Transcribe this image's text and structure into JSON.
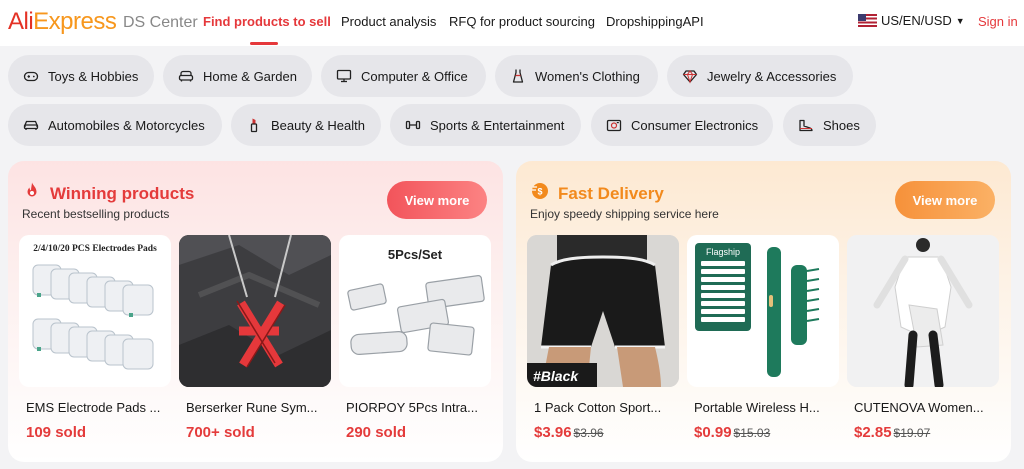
{
  "header": {
    "logo": {
      "ali": "Ali",
      "express": "Express"
    },
    "ds_center": "DS Center",
    "nav": [
      {
        "label": "Find products to sell",
        "active": true
      },
      {
        "label": "Product analysis"
      },
      {
        "label": "RFQ for product sourcing"
      },
      {
        "label": "DropshippingAPI"
      }
    ],
    "region": "US/EN/USD",
    "region_icon": "us-flag-icon",
    "sign_in": "Sign in"
  },
  "categories": [
    {
      "label": "Toys & Hobbies",
      "icon": "gamepad-icon"
    },
    {
      "label": "Home & Garden",
      "icon": "sofa-icon"
    },
    {
      "label": "Computer & Office",
      "icon": "monitor-icon"
    },
    {
      "label": "Women's Clothing",
      "icon": "dress-icon"
    },
    {
      "label": "Jewelry & Accessories",
      "icon": "diamond-icon"
    },
    {
      "label": "Automobiles & Motorcycles",
      "icon": "car-icon"
    },
    {
      "label": "Beauty & Health",
      "icon": "lipstick-icon"
    },
    {
      "label": "Sports & Entertainment",
      "icon": "dumbbell-icon"
    },
    {
      "label": "Consumer Electronics",
      "icon": "camera-icon"
    },
    {
      "label": "Shoes",
      "icon": "shoe-icon"
    }
  ],
  "winning": {
    "title": "Winning products",
    "subtitle": "Recent bestselling products",
    "view_more": "View more",
    "icon": "flame-icon",
    "accent": "#e43b3b",
    "products": [
      {
        "title": "EMS Electrode Pads ...",
        "sold": "109 sold",
        "image_text": "2/4/10/20 PCS Electrodes Pads"
      },
      {
        "title": "Berserker Rune Sym...",
        "sold": "700+ sold"
      },
      {
        "title": "PIORPOY 5Pcs Intra...",
        "sold": "290 sold",
        "image_text": "5Pcs/Set"
      }
    ]
  },
  "fast": {
    "title": "Fast Delivery",
    "subtitle": "Enjoy speedy shipping service here",
    "view_more": "View more",
    "icon": "fast-delivery-icon",
    "accent": "#f28a1d",
    "products": [
      {
        "title": "1 Pack Cotton Sport...",
        "price": "$3.96",
        "old_price": "$3.96",
        "image_text": "#Black"
      },
      {
        "title": "Portable Wireless H...",
        "price": "$0.99",
        "old_price": "$15.03",
        "image_text": "Flagship"
      },
      {
        "title": "CUTENOVA Women...",
        "price": "$2.85",
        "old_price": "$19.07"
      }
    ]
  }
}
